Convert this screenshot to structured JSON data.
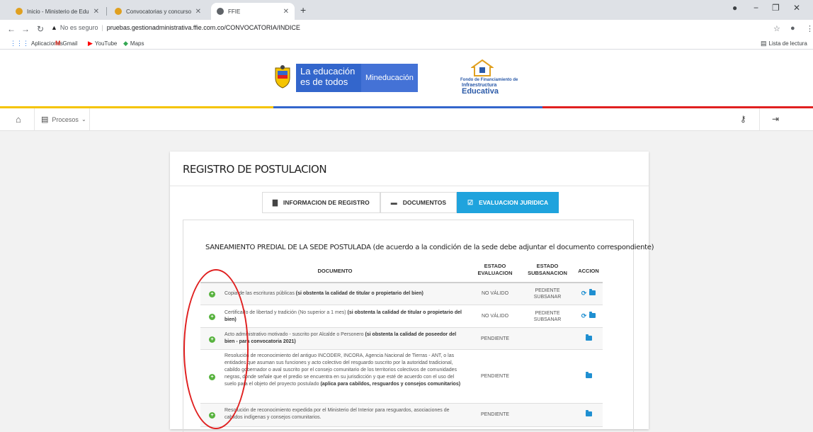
{
  "browser": {
    "tabs": [
      {
        "title": "Inicio - Ministerio de Educación N",
        "active": false,
        "fav_color": "#e0a020"
      },
      {
        "title": "Convocatorias y concursos - Min",
        "active": false,
        "fav_color": "#e0a020"
      },
      {
        "title": "FFIE",
        "active": true,
        "fav_color": "#5f6368"
      }
    ],
    "close_glyph": "✕",
    "new_tab_glyph": "+",
    "url_insecure_label": "No es seguro",
    "url": "pruebas.gestionadministrativa.ffie.com.co/CONVOCATORIA/INDICE",
    "bookmarks": [
      "Aplicaciones",
      "Gmail",
      "YouTube",
      "Maps"
    ],
    "reading_list": "Lista de lectura"
  },
  "site": {
    "brand_line1": "La educación",
    "brand_line2": "es de todos",
    "ministry": "Mineducación",
    "infra_small": "Fondo de Financiamiento de",
    "infra_line1": "Infraestructura",
    "infra_line2": "Educativa",
    "stripe_colors": [
      "#f5c400",
      "#3366cc",
      "#e02020"
    ]
  },
  "nav": {
    "processes_label": "Procesos"
  },
  "page": {
    "title": "REGISTRO DE POSTULACION",
    "tabs": [
      {
        "label": "INFORMACION DE REGISTRO",
        "icon": "file-icon",
        "active": false
      },
      {
        "label": "DOCUMENTOS",
        "icon": "folder-icon",
        "active": false
      },
      {
        "label": "EVALUACION JURIDICA",
        "icon": "check-square-icon",
        "active": true
      }
    ],
    "section_title": "SANEAMIENTO PREDIAL DE LA SEDE POSTULADA (de acuerdo a la condición de la sede debe adjuntar el documento correspondiente)",
    "columns": {
      "documento": "DOCUMENTO",
      "estado_eval_1": "ESTADO",
      "estado_eval_2": "EVALUACION",
      "estado_sub_1": "ESTADO",
      "estado_sub_2": "SUBSANACION",
      "accion": "ACCION"
    },
    "rows": [
      {
        "text": "Copia de las escrituras públicas ",
        "bold": "(si obstenta la calidad de titular o propietario del bien)",
        "evaluacion": "NO VÁLIDO",
        "subsanacion": "PEDIENTE SUBSANAR",
        "refresh": true
      },
      {
        "text": "Certificado de libertad y tradición (No superior a 1 mes) ",
        "bold": "(si obstenta la calidad de titular o propietario del bien)",
        "evaluacion": "NO VÁLIDO",
        "subsanacion": "PEDIENTE SUBSANAR",
        "refresh": true
      },
      {
        "text": "Acto administrativo motivado - suscrito por Alcalde o Personero ",
        "bold": "(si obstenta la calidad de poseedor del bien - para convocatoria 2021)",
        "evaluacion": "PENDIENTE",
        "subsanacion": "",
        "refresh": false
      },
      {
        "text": "Resolución de reconocimiento del antiguo INCODER, INCORA, Agencia Nacional de Tierras - ANT, o las entidades que asuman sus funciones y acto colectivo del resguardo suscrito por la autoridad tradicional, cabildo gobernador o aval suscrito por el consejo comunitario de los territorios colectivos de comunidades negras, donde señale que el predio se encuentra en su jurisdicción y que esté de acuerdo con el uso del suelo para el objeto del proyecto postulado ",
        "bold": "(aplica para cabildos, resguardos y consejos comunitarios)",
        "evaluacion": "PENDIENTE",
        "subsanacion": "",
        "refresh": false
      },
      {
        "text": "Resolución de reconocimiento expedida por el Ministerio del Interior para resguardos, asociaciones de cabildos indígenas y consejos comunitarios.",
        "bold": "",
        "evaluacion": "PENDIENTE",
        "subsanacion": "",
        "refresh": false
      }
    ]
  },
  "colors": {
    "accent_tab": "#1fa3dd",
    "plus_green": "#58b33f",
    "action_blue": "#1f8fd1",
    "annotation_red": "#e02020"
  }
}
